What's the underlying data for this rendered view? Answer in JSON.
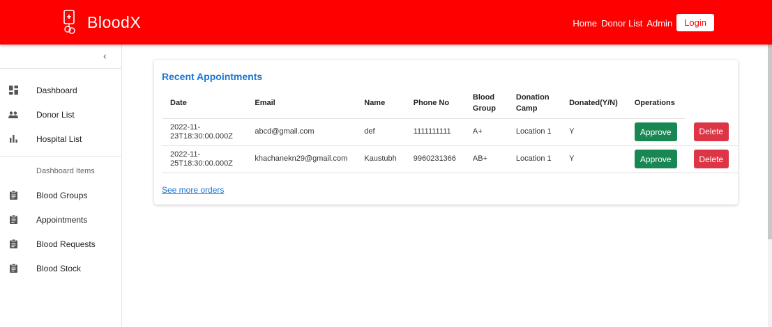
{
  "brand": {
    "name": "BloodX"
  },
  "nav": {
    "home": "Home",
    "donor_list": "Donor List",
    "admin": "Admin",
    "login": "Login"
  },
  "sidebar": {
    "items": [
      {
        "label": "Dashboard",
        "icon": "dashboard-icon"
      },
      {
        "label": "Donor List",
        "icon": "people-icon"
      },
      {
        "label": "Hospital List",
        "icon": "bar-chart-icon"
      }
    ],
    "subheader": "Dashboard Items",
    "dashboard_items": [
      {
        "label": "Blood Groups",
        "icon": "clipboard-icon"
      },
      {
        "label": "Appointments",
        "icon": "clipboard-icon"
      },
      {
        "label": "Blood Requests",
        "icon": "clipboard-icon"
      },
      {
        "label": "Blood Stock",
        "icon": "clipboard-icon"
      }
    ]
  },
  "card": {
    "title": "Recent Appointments",
    "headers": {
      "date": "Date",
      "email": "Email",
      "name": "Name",
      "phone": "Phone No",
      "blood_l1": "Blood",
      "blood_l2": "Group",
      "camp_l1": "Donation",
      "camp_l2": "Camp",
      "donated": "Donated(Y/N)",
      "ops": "Operations"
    },
    "rows": [
      {
        "date_l1": "2022-11-",
        "date_l2": "23T18:30:00.000Z",
        "email": "abcd@gmail.com",
        "name": "def",
        "phone": "1111111111",
        "blood": "A+",
        "camp": "Location 1",
        "donated": "Y"
      },
      {
        "date_l1": "2022-11-",
        "date_l2": "25T18:30:00.000Z",
        "email": "khachanekn29@gmail.com",
        "name": "Kaustubh",
        "phone": "9960231366",
        "blood": "AB+",
        "camp": "Location 1",
        "donated": "Y"
      }
    ],
    "approve_label": "Approve",
    "delete_label": "Delete",
    "see_more": "See more orders"
  },
  "colors": {
    "header": "#ff0000",
    "link": "#1976d2",
    "approve": "#198754",
    "delete": "#dc3545"
  }
}
